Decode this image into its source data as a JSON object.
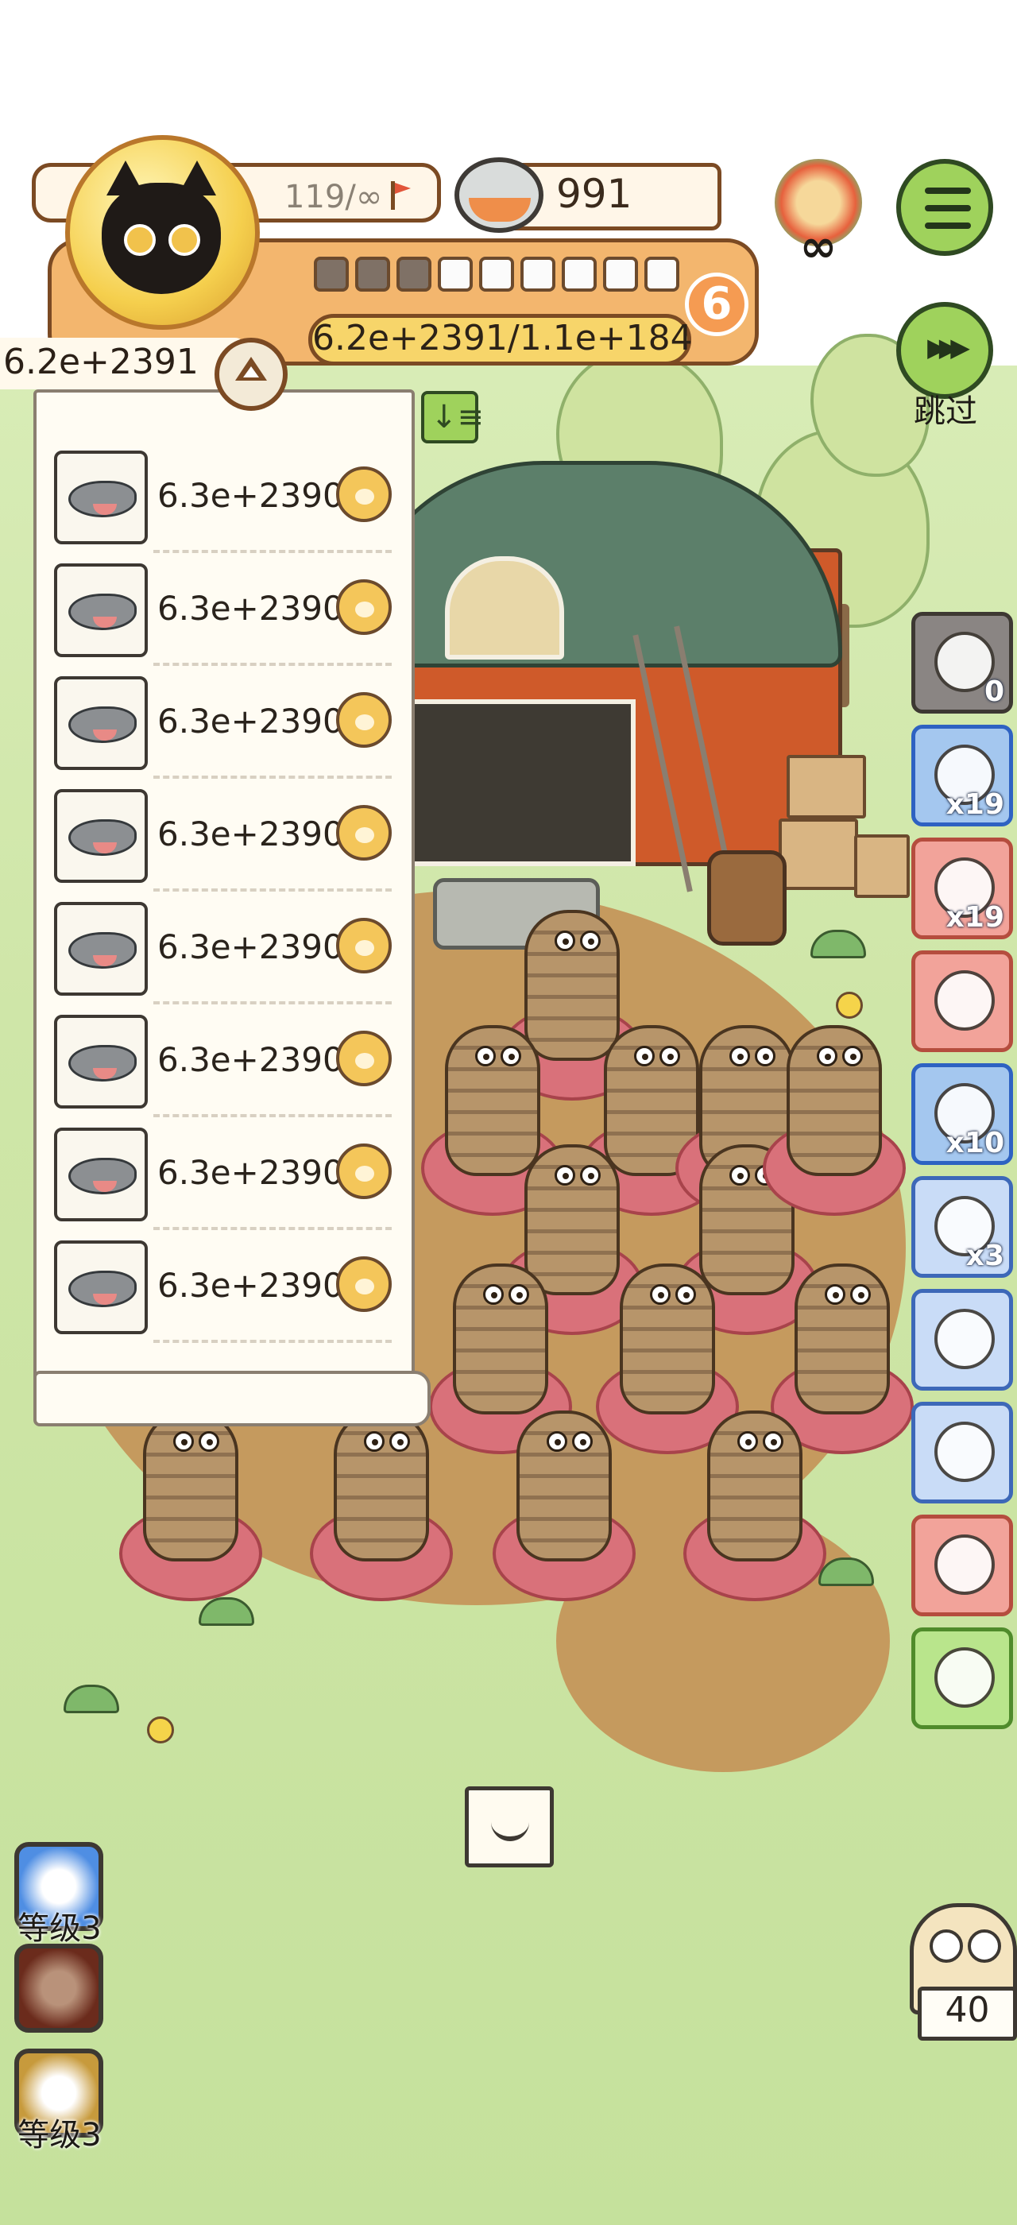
{
  "hud": {
    "level": "119/∞",
    "coins": "991",
    "stage_progress": {
      "filled": 3,
      "total": 9
    },
    "damage_progress": "6.2e+2391/1.1e+184",
    "stage_badge": "6",
    "boss_count_symbol": "∞",
    "skip_label": "跳过"
  },
  "damage_list": {
    "total": "6.2e+2391",
    "rows": [
      {
        "pet": "dolphin",
        "value": "6.3e+2390"
      },
      {
        "pet": "dolphin",
        "value": "6.3e+2390"
      },
      {
        "pet": "dolphin",
        "value": "6.3e+2390"
      },
      {
        "pet": "dolphin",
        "value": "6.3e+2390"
      },
      {
        "pet": "dolphin",
        "value": "6.3e+2390"
      },
      {
        "pet": "dolphin",
        "value": "6.3e+2390"
      },
      {
        "pet": "dolphin",
        "value": "6.3e+2390"
      },
      {
        "pet": "dolphin",
        "value": "6.3e+2390"
      }
    ]
  },
  "items": [
    {
      "name": "paw-bag",
      "count": "0"
    },
    {
      "name": "blue-fan",
      "count": "x19"
    },
    {
      "name": "diving-mask",
      "count": "x19"
    },
    {
      "name": "jingle-bell",
      "count": ""
    },
    {
      "name": "ring",
      "count": "x10"
    },
    {
      "name": "hourglass",
      "count": "x3"
    },
    {
      "name": "feather",
      "count": ""
    },
    {
      "name": "hut",
      "count": ""
    },
    {
      "name": "green-bomb",
      "count": ""
    },
    {
      "name": "card",
      "count": ""
    }
  ],
  "skills": [
    {
      "name": "blue-orb",
      "label": "等级3"
    },
    {
      "name": "bag",
      "label": ""
    },
    {
      "name": "paw-bone",
      "label": "等级3"
    }
  ],
  "owl_count": "40",
  "colors": {
    "accent": "#f3b66e",
    "menu_green": "#9fd25c",
    "badge_orange": "#f59b52"
  }
}
